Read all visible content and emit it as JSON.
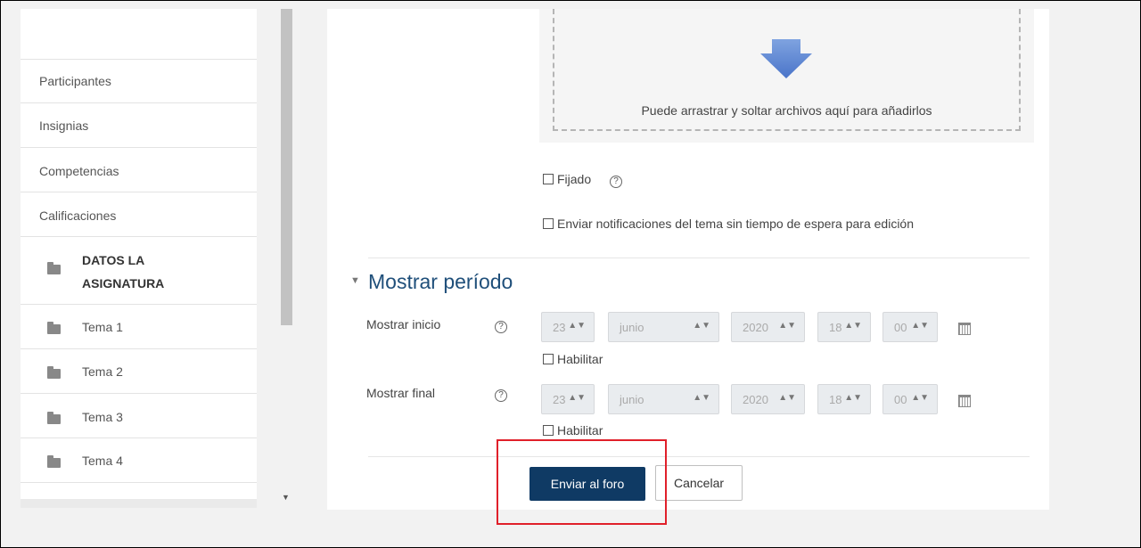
{
  "sidebar": {
    "items": [
      {
        "label": "Participantes"
      },
      {
        "label": "Insignias"
      },
      {
        "label": "Competencias"
      },
      {
        "label": "Calificaciones"
      }
    ],
    "sections": [
      {
        "label_line1": "DATOS LA",
        "label_line2": "ASIGNATURA",
        "icon": "folder-icon"
      },
      {
        "label": "Tema 1",
        "icon": "folder-icon"
      },
      {
        "label": "Tema 2",
        "icon": "folder-icon"
      },
      {
        "label": "Tema 3",
        "icon": "folder-icon"
      },
      {
        "label": "Tema 4",
        "icon": "folder-icon"
      }
    ]
  },
  "filepicker": {
    "drop_text": "Puede arrastrar y soltar archivos aquí para añadirlos",
    "icon": "down-arrow-icon"
  },
  "options": {
    "pinned_label": "Fijado",
    "notify_label": "Enviar notificaciones del tema sin tiempo de espera para edición"
  },
  "display_period": {
    "title": "Mostrar período",
    "start": {
      "label": "Mostrar inicio",
      "day": "23",
      "month": "junio",
      "year": "2020",
      "hour": "18",
      "minute": "00",
      "enable_label": "Habilitar"
    },
    "end": {
      "label": "Mostrar final",
      "day": "23",
      "month": "junio",
      "year": "2020",
      "hour": "18",
      "minute": "00",
      "enable_label": "Habilitar"
    }
  },
  "actions": {
    "submit_label": "Enviar al foro",
    "cancel_label": "Cancelar"
  },
  "colors": {
    "primary": "#0f3a64",
    "section_title": "#1f4f7a",
    "highlight": "#e0202a"
  }
}
